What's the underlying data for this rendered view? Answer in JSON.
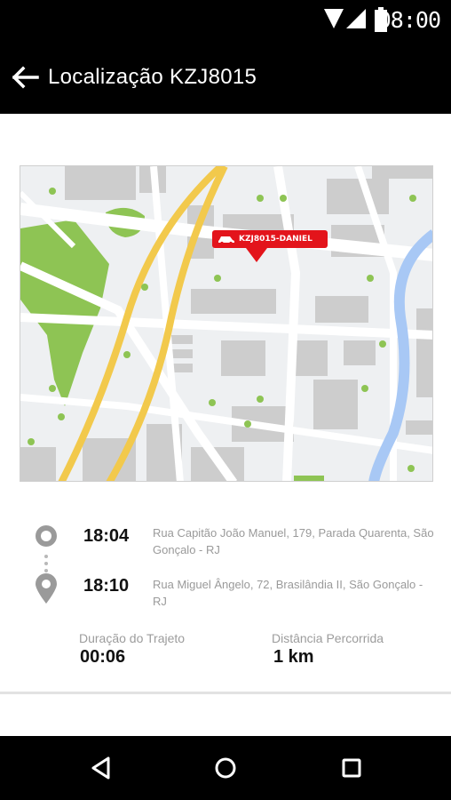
{
  "status_bar": {
    "time": "08:00",
    "icons": [
      "wifi-icon",
      "signal-icon",
      "battery-icon"
    ]
  },
  "app_bar": {
    "title": "Localização KZJ8015",
    "back_icon": "arrow-left-icon"
  },
  "map": {
    "marker_label": "KZJ8015-DANIEL",
    "marker_color": "#e3141b",
    "road_color": "#f2c94c",
    "park_color": "#8ec454",
    "water_color": "#a8c8f5"
  },
  "trip": {
    "stops": [
      {
        "time": "18:04",
        "address": "Rua Capitão João Manuel, 179, Parada Quarenta, São Gonçalo - RJ",
        "icon": "origin-pin-icon"
      },
      {
        "time": "18:10",
        "address": "Rua Miguel Ângelo, 72, Brasilândia II, São Gonçalo - RJ",
        "icon": "destination-pin-icon"
      }
    ],
    "duration_label": "Duração do Trajeto",
    "duration_value": "00:06",
    "distance_label": "Distância Percorrida",
    "distance_value": "1 km"
  },
  "nav_bar": {
    "back": "nav-back-icon",
    "home": "nav-home-icon",
    "recents": "nav-recents-icon"
  }
}
